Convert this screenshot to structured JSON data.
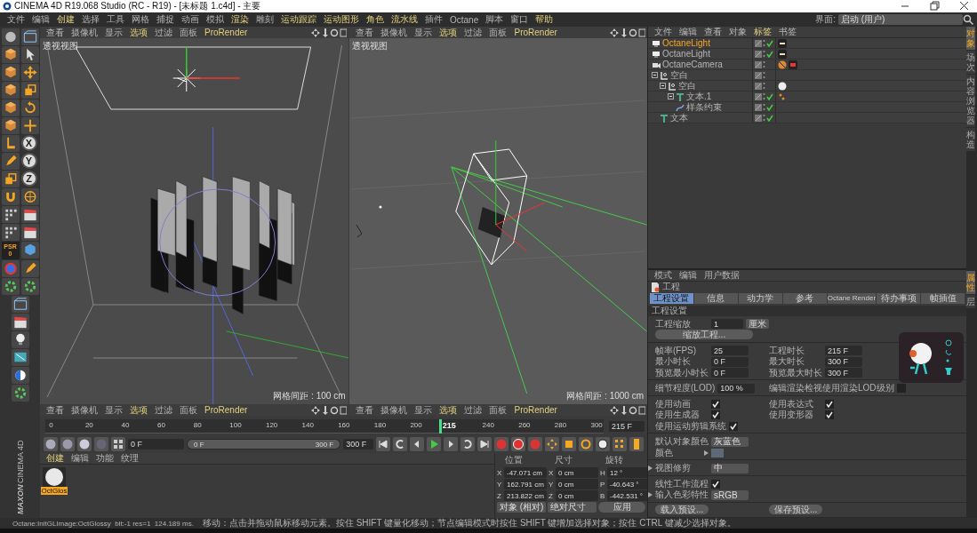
{
  "window": {
    "title": "CINEMA 4D R19.068 Studio (RC - R19) - [未标题 1.c4d] - 主要"
  },
  "menu_bar": [
    {
      "label": "文件",
      "accent": false
    },
    {
      "label": "编辑",
      "accent": false
    },
    {
      "label": "创建",
      "accent": true
    },
    {
      "label": "选择",
      "accent": false
    },
    {
      "label": "工具",
      "accent": false
    },
    {
      "label": "网格",
      "accent": false
    },
    {
      "label": "捕捉",
      "accent": false
    },
    {
      "label": "动画",
      "accent": false
    },
    {
      "label": "模拟",
      "accent": false
    },
    {
      "label": "渲染",
      "accent": true
    },
    {
      "label": "雕刻",
      "accent": false
    },
    {
      "label": "运动跟踪",
      "accent": true
    },
    {
      "label": "运动图形",
      "accent": true
    },
    {
      "label": "角色",
      "accent": true
    },
    {
      "label": "流水线",
      "accent": true
    },
    {
      "label": "插件",
      "accent": false
    },
    {
      "label": "Octane",
      "accent": false
    },
    {
      "label": "脚本",
      "accent": false
    },
    {
      "label": "窗口",
      "accent": false
    },
    {
      "label": "帮助",
      "accent": true
    }
  ],
  "layout_selector": {
    "label": "界面:",
    "value": "启动 (用户)"
  },
  "left_toolbar": {
    "axis_buttons": [
      "X",
      "Y",
      "Z"
    ],
    "psr": {
      "label": "PSR",
      "value": "0"
    }
  },
  "logo": {
    "brand": "MAXON",
    "product": "CINEMA 4D"
  },
  "viewports": [
    {
      "kind": "front",
      "title": "透视视图",
      "grid_spacing": "网格间距 : 100 cm",
      "menu": [
        {
          "label": "查看",
          "accent": false
        },
        {
          "label": "摄像机",
          "accent": false
        },
        {
          "label": "显示",
          "accent": false
        },
        {
          "label": "选项",
          "accent": true
        },
        {
          "label": "过滤",
          "accent": false
        },
        {
          "label": "面板",
          "accent": false
        },
        {
          "label": "ProRender",
          "accent": true
        }
      ]
    },
    {
      "kind": "camera",
      "title": "透视视图",
      "grid_spacing": "网格间距 : 1000 cm",
      "menu": [
        {
          "label": "查看",
          "accent": false
        },
        {
          "label": "摄像机",
          "accent": false
        },
        {
          "label": "显示",
          "accent": false
        },
        {
          "label": "选项",
          "accent": true
        },
        {
          "label": "过滤",
          "accent": false
        },
        {
          "label": "面板",
          "accent": false
        },
        {
          "label": "ProRender",
          "accent": true
        }
      ]
    }
  ],
  "lower_viewports": [
    {
      "menu": [
        {
          "label": "查看",
          "accent": false
        },
        {
          "label": "摄像机",
          "accent": false
        },
        {
          "label": "显示",
          "accent": false
        },
        {
          "label": "选项",
          "accent": true
        },
        {
          "label": "过滤",
          "accent": false
        },
        {
          "label": "面板",
          "accent": false
        },
        {
          "label": "ProRender",
          "accent": true
        }
      ]
    },
    {
      "menu": [
        {
          "label": "查看",
          "accent": false
        },
        {
          "label": "摄像机",
          "accent": false
        },
        {
          "label": "显示",
          "accent": false
        },
        {
          "label": "选项",
          "accent": true
        },
        {
          "label": "过滤",
          "accent": false
        },
        {
          "label": "面板",
          "accent": false
        },
        {
          "label": "ProRender",
          "accent": true
        }
      ]
    }
  ],
  "timeline": {
    "ticks_before": [
      "0",
      "20",
      "40",
      "60",
      "80",
      "100",
      "120",
      "140",
      "160",
      "180",
      "200"
    ],
    "ticks_after": [
      "240",
      "260",
      "280",
      "300"
    ],
    "playhead": {
      "label": "215",
      "level": 0.7167
    },
    "current_frame": "215 F"
  },
  "transport": {
    "start_field": "0 F",
    "range": {
      "start": "0 F",
      "end": "300 F",
      "level": 1
    },
    "end_field": "300 F"
  },
  "material_manager": {
    "menu": [
      {
        "label": "创建",
        "accent": true
      },
      {
        "label": "编辑",
        "accent": false
      },
      {
        "label": "功能",
        "accent": false
      },
      {
        "label": "纹理",
        "accent": false
      }
    ],
    "materials": [
      {
        "name": "OctGlos",
        "selected": true
      }
    ]
  },
  "coordinates": {
    "headers": [
      "位置",
      "尺寸",
      "旋转"
    ],
    "rows": [
      {
        "axis_a": "X",
        "position": "-47.071 cm",
        "axis_b": "X",
        "size": "0 cm",
        "axis_c": "H",
        "rotation": "12 °"
      },
      {
        "axis_a": "Y",
        "position": "162.791 cm",
        "axis_b": "Y",
        "size": "0 cm",
        "axis_c": "P",
        "rotation": "-40.643 °"
      },
      {
        "axis_a": "Z",
        "position": "213.822 cm",
        "axis_b": "Z",
        "size": "0 cm",
        "axis_c": "B",
        "rotation": "-442.531 °"
      }
    ],
    "mode": "对象 (相对)",
    "size_mode": "绝对尺寸",
    "apply": "应用"
  },
  "status_bar": {
    "info": "Octane:InitGLImage:OctGlossy  bit:-1 res=1  124.189 ms.",
    "message": "移动：点击并拖动鼠标移动元素。按住 SHIFT 键量化移动；节点编辑模式时按住 SHIFT 键增加选择对象；按住 CTRL 键减少选择对象。"
  },
  "object_manager": {
    "menu": [
      {
        "label": "文件",
        "accent": false
      },
      {
        "label": "编辑",
        "accent": false
      },
      {
        "label": "查看",
        "accent": false
      },
      {
        "label": "对象",
        "accent": false
      },
      {
        "label": "标签",
        "accent": true
      },
      {
        "label": "书签",
        "accent": false
      }
    ],
    "objects": [
      {
        "name": "OctaneLight",
        "kind": "light",
        "selected": true,
        "checked": true
      },
      {
        "name": "OctaneLight",
        "kind": "light",
        "selected": false,
        "checked": true
      },
      {
        "name": "OctaneCamera",
        "kind": "camera",
        "selected": false,
        "checked": false
      },
      {
        "name": "空白",
        "kind": "null",
        "selected": false,
        "checked": false,
        "expanded": true,
        "children": [
          {
            "name": "空白",
            "kind": "null",
            "selected": false,
            "checked": false,
            "expanded": true,
            "material_tag": true,
            "children": [
              {
                "name": "文本.1",
                "kind": "text",
                "selected": false,
                "checked": true,
                "expanded": true,
                "selection_tag": true,
                "children": [
                  {
                    "name": "样条约束",
                    "kind": "spline",
                    "selected": false,
                    "checked": true
                  }
                ]
              }
            ]
          },
          {
            "name": "文本",
            "kind": "text",
            "selected": false,
            "checked": true
          }
        ]
      }
    ]
  },
  "attributes": {
    "menu": [
      "模式",
      "编辑",
      "用户数据"
    ],
    "title": "工程",
    "tabs": [
      {
        "label": "工程设置",
        "selected": true
      },
      {
        "label": "信息",
        "selected": false
      },
      {
        "label": "动力学",
        "selected": false
      },
      {
        "label": "参考",
        "selected": false
      },
      {
        "label": "Octane Render",
        "selected": false
      },
      {
        "label": "待办事项",
        "selected": false
      },
      {
        "label": "帧插值",
        "selected": false
      }
    ],
    "section": "工程设置",
    "groups": [
      [
        [
          {
            "label": "工程缩放",
            "kind": "number-unit",
            "value": "1",
            "unit": "厘米"
          }
        ],
        [
          {
            "label": "缩放工程...",
            "kind": "wide-button"
          }
        ]
      ],
      [
        [
          {
            "label": "帧率(FPS)",
            "kind": "number",
            "value": "25"
          },
          {
            "label": "工程时长",
            "kind": "number",
            "value": "215 F"
          }
        ],
        [
          {
            "label": "最小时长",
            "kind": "number",
            "value": "0 F"
          },
          {
            "label": "最大时长",
            "kind": "number",
            "value": "300 F"
          }
        ],
        [
          {
            "label": "预览最小时长",
            "kind": "number",
            "value": "0 F"
          },
          {
            "label": "预览最大时长",
            "kind": "number",
            "value": "300 F"
          }
        ]
      ],
      [
        [
          {
            "label": "细节程度(LOD)",
            "kind": "number",
            "value": "100 %"
          },
          {
            "label": "编辑渲染检视使用渲染LOD级别",
            "kind": "checkbox",
            "checked": false
          }
        ]
      ],
      [
        [
          {
            "label": "使用动画",
            "kind": "checkbox",
            "checked": true
          },
          {
            "label": "使用表达式",
            "kind": "checkbox",
            "checked": true
          }
        ],
        [
          {
            "label": "使用生成器",
            "kind": "checkbox",
            "checked": true
          },
          {
            "label": "使用变形器",
            "kind": "checkbox",
            "checked": true
          }
        ],
        [
          {
            "label": "使用运动剪辑系统",
            "kind": "checkbox",
            "checked": true
          }
        ]
      ],
      [
        [
          {
            "label": "默认对象颜色",
            "kind": "dropdown",
            "value": "灰蓝色"
          }
        ],
        [
          {
            "label": "颜色",
            "kind": "color"
          }
        ]
      ],
      [
        [
          {
            "label": "视图修剪",
            "kind": "dropdown",
            "value": "中",
            "expandable": true
          }
        ]
      ],
      [
        [
          {
            "label": "线性工作流程",
            "kind": "checkbox",
            "checked": true
          }
        ],
        [
          {
            "label": "输入色彩特性",
            "kind": "dropdown",
            "value": "sRGB",
            "expandable": true
          }
        ]
      ],
      [
        [
          {
            "label": "载入预设...",
            "kind": "button"
          },
          {
            "label": "保存预设...",
            "kind": "button"
          }
        ]
      ]
    ]
  },
  "side_tabs_top": [
    {
      "label": "对象",
      "selected": true
    },
    {
      "label": "场次",
      "selected": false
    },
    {
      "label": "内容浏览器",
      "selected": false
    },
    {
      "label": "构造",
      "selected": false
    }
  ],
  "side_tabs_bottom": [
    {
      "label": "属性",
      "selected": true
    },
    {
      "label": "层",
      "selected": false
    }
  ]
}
